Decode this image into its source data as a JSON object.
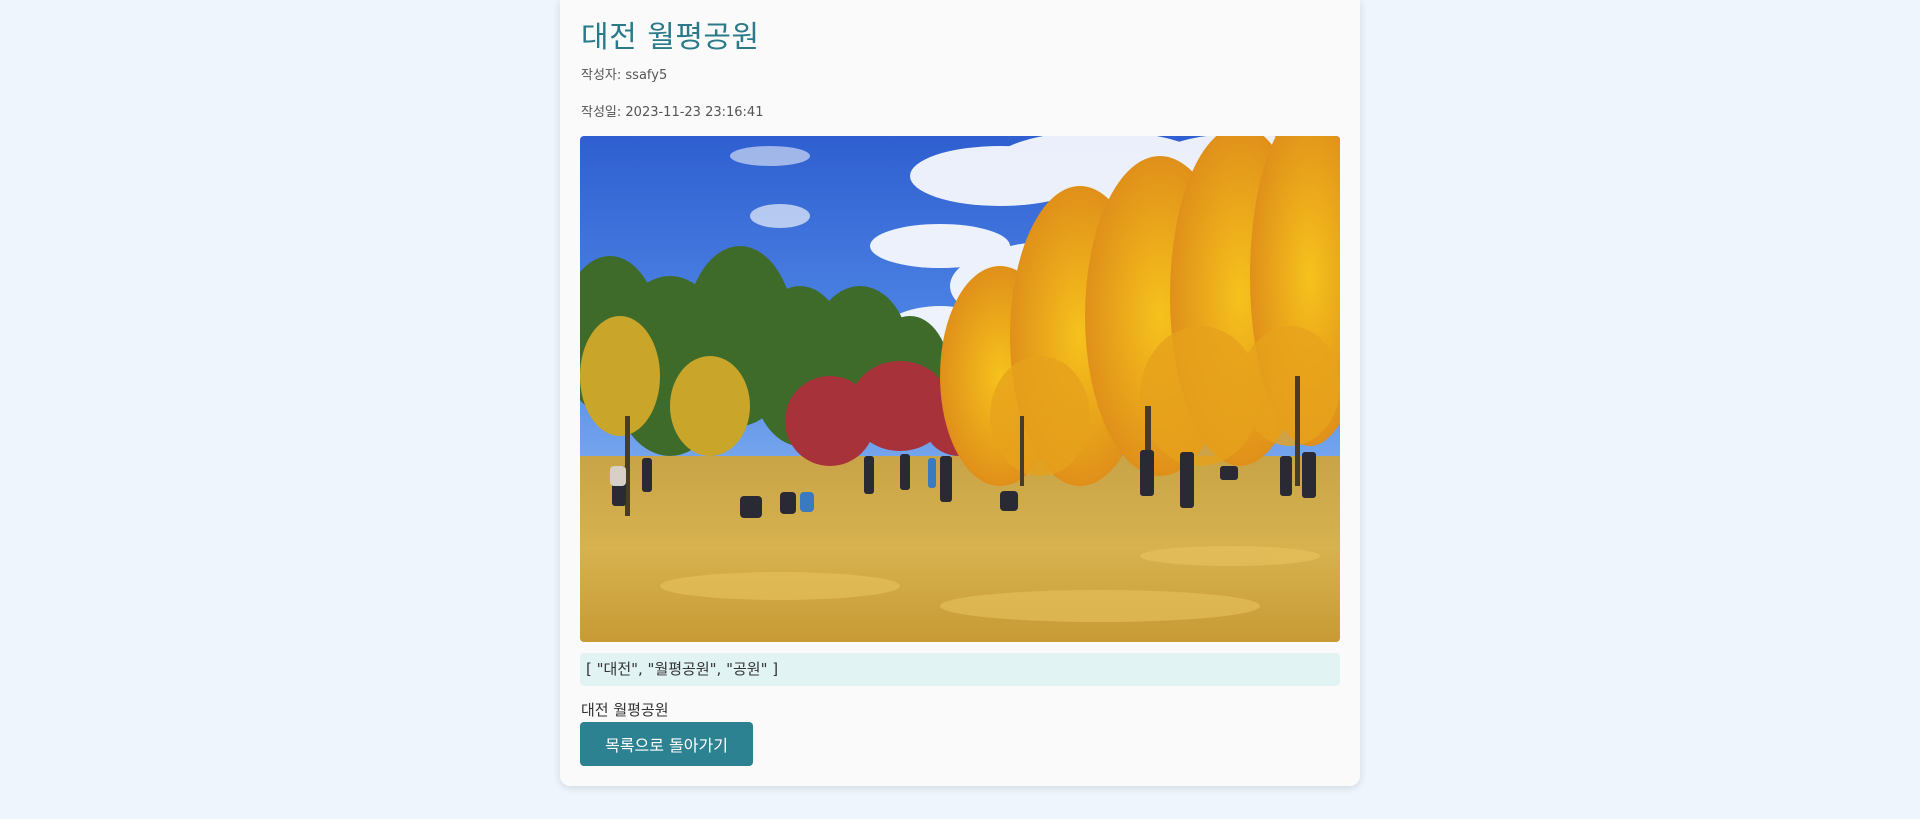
{
  "post": {
    "title": "대전 월평공원",
    "author_label": "작성자:",
    "author": "ssafy5",
    "date_label": "작성일:",
    "date": "2023-11-23 23:16:41",
    "tags": "[ \"대전\", \"월평공원\", \"공원\" ]",
    "content": "대전 월평공원"
  },
  "actions": {
    "back_label": "목록으로 돌아가기"
  },
  "colors": {
    "accent": "#2c8290",
    "title": "#2b7a8a",
    "tag_bg": "#e1f3f3",
    "page_bg": "#eef5fc"
  }
}
